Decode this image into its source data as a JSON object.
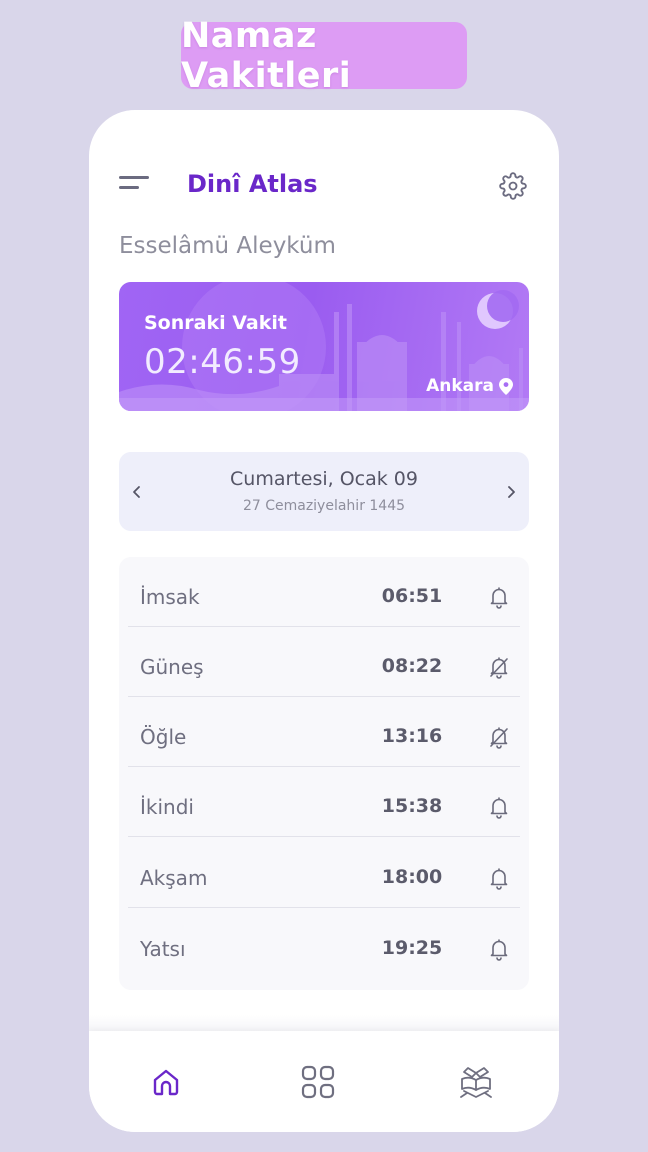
{
  "banner": {
    "title": "Namaz Vakitleri"
  },
  "app": {
    "title": "Dinî Atlas",
    "greeting": "Esselâmü Aleyküm"
  },
  "icons": {
    "menu": "menu-icon",
    "settings": "gear-icon",
    "location": "location-pin-icon",
    "moon": "crescent-moon-icon",
    "prev": "chevron-left-icon",
    "next": "chevron-right-icon",
    "bell_on": "bell-icon",
    "bell_off": "bell-off-icon",
    "home": "home-icon",
    "grid": "grid-icon",
    "quran": "quran-book-icon"
  },
  "next_prayer": {
    "label": "Sonraki Vakit",
    "countdown": "02:46:59",
    "city": "Ankara"
  },
  "date": {
    "gregorian": "Cumartesi, Ocak 09",
    "hijri": "27 Cemaziyelahir 1445"
  },
  "prayers": [
    {
      "name": "İmsak",
      "time": "06:51",
      "alarm": true
    },
    {
      "name": "Güneş",
      "time": "08:22",
      "alarm": false
    },
    {
      "name": "Öğle",
      "time": "13:16",
      "alarm": false
    },
    {
      "name": "İkindi",
      "time": "15:38",
      "alarm": true
    },
    {
      "name": "Akşam",
      "time": "18:00",
      "alarm": true
    },
    {
      "name": "Yatsı",
      "time": "19:25",
      "alarm": true
    }
  ],
  "colors": {
    "background": "#d9d6ea",
    "banner": "#dd9cf4",
    "accent": "#6a27c9",
    "hero_gradient_start": "#a065f4",
    "hero_gradient_end": "#b27af5",
    "active_nav": "#6a27c9",
    "inactive_nav": "#6f6f80"
  },
  "nav": {
    "active": "home"
  }
}
